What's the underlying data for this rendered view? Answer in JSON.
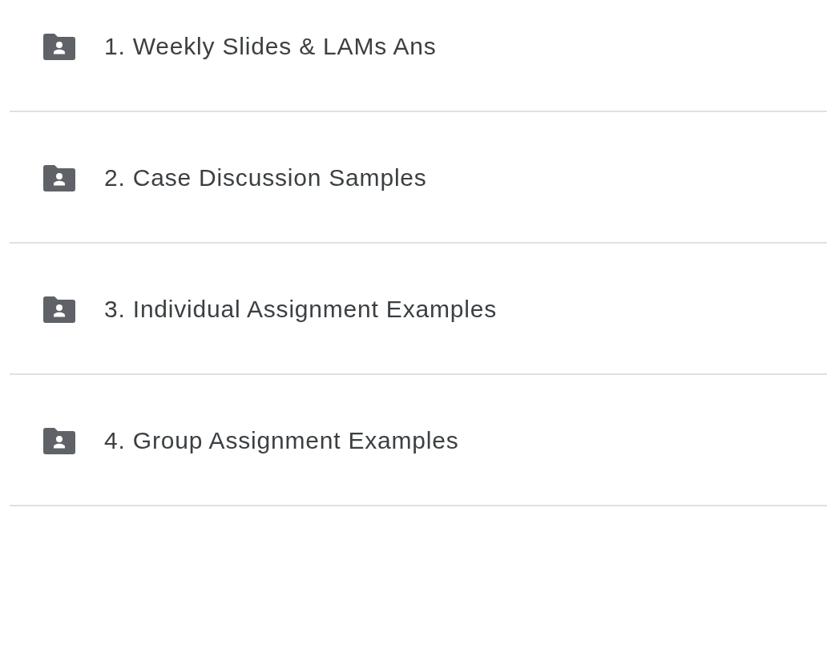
{
  "folders": [
    {
      "name": "1. Weekly Slides & LAMs Ans"
    },
    {
      "name": "2. Case Discussion Samples"
    },
    {
      "name": "3. Individual Assignment Examples"
    },
    {
      "name": "4. Group Assignment Examples"
    }
  ]
}
